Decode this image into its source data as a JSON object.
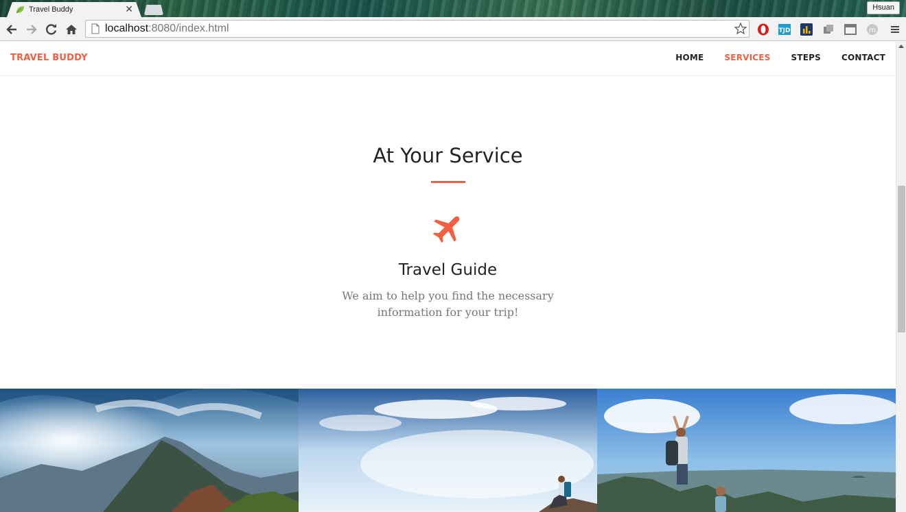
{
  "browser": {
    "tab_title": "Travel Buddy",
    "profile_name": "Hsuan",
    "url_host": "localhost",
    "url_rest": ":8080/index.html",
    "extensions": [
      "opera-icon",
      "tjd-icon",
      "chart-icon",
      "puzzle-icon",
      "window-icon",
      "m-icon",
      "menu-icon"
    ]
  },
  "site": {
    "brand": "TRAVEL BUDDY",
    "nav": [
      {
        "label": "HOME",
        "active": false
      },
      {
        "label": "SERVICES",
        "active": true
      },
      {
        "label": "STEPS",
        "active": false
      },
      {
        "label": "CONTACT",
        "active": false
      }
    ]
  },
  "services": {
    "title": "At Your Service",
    "item": {
      "icon": "plane-icon",
      "heading": "Travel Guide",
      "text_line1": "We aim to help you find the necessary",
      "text_line2": "information for your trip!"
    }
  },
  "gallery": {
    "photos": [
      "mountain-landscape-photo",
      "sky-hiker-photo",
      "hikers-summit-photo"
    ]
  },
  "colors": {
    "accent": "#f05f40",
    "heading": "#222222",
    "muted": "#777777"
  }
}
